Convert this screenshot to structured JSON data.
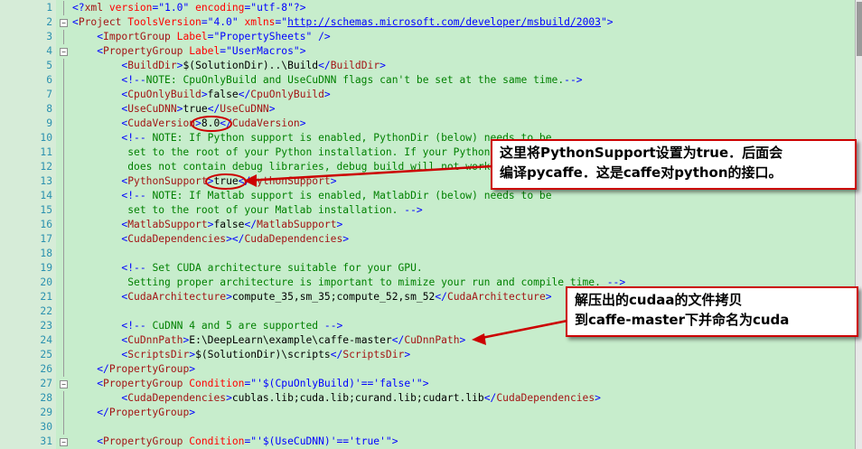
{
  "lines": [
    {
      "n": "1",
      "fold": "",
      "tokens": [
        [
          "t-blue",
          "<?"
        ],
        [
          "t-tag",
          "xml"
        ],
        [
          "t-attr",
          " version"
        ],
        [
          "t-blue",
          "="
        ],
        [
          "t-str",
          "\"1.0\""
        ],
        [
          "t-attr",
          " encoding"
        ],
        [
          "t-blue",
          "="
        ],
        [
          "t-str",
          "\"utf-8\""
        ],
        [
          "t-blue",
          "?>"
        ]
      ]
    },
    {
      "n": "2",
      "fold": "−",
      "tokens": [
        [
          "t-blue",
          "<"
        ],
        [
          "t-tag",
          "Project"
        ],
        [
          "t-attr",
          " ToolsVersion"
        ],
        [
          "t-blue",
          "="
        ],
        [
          "t-str",
          "\"4.0\""
        ],
        [
          "t-attr",
          " xmlns"
        ],
        [
          "t-blue",
          "="
        ],
        [
          "t-str",
          "\""
        ],
        [
          "t-url",
          "http://schemas.microsoft.com/developer/msbuild/2003"
        ],
        [
          "t-str",
          "\""
        ],
        [
          "t-blue",
          ">"
        ]
      ]
    },
    {
      "n": "3",
      "fold": "",
      "tokens": [
        [
          "t-txt",
          "    "
        ],
        [
          "t-blue",
          "<"
        ],
        [
          "t-tag",
          "ImportGroup"
        ],
        [
          "t-attr",
          " Label"
        ],
        [
          "t-blue",
          "="
        ],
        [
          "t-str",
          "\"PropertySheets\""
        ],
        [
          "t-blue",
          " />"
        ]
      ]
    },
    {
      "n": "4",
      "fold": "−",
      "tokens": [
        [
          "t-txt",
          "    "
        ],
        [
          "t-blue",
          "<"
        ],
        [
          "t-tag",
          "PropertyGroup"
        ],
        [
          "t-attr",
          " Label"
        ],
        [
          "t-blue",
          "="
        ],
        [
          "t-str",
          "\"UserMacros\""
        ],
        [
          "t-blue",
          ">"
        ]
      ]
    },
    {
      "n": "5",
      "fold": "",
      "tokens": [
        [
          "t-txt",
          "        "
        ],
        [
          "t-blue",
          "<"
        ],
        [
          "t-tag",
          "BuildDir"
        ],
        [
          "t-blue",
          ">"
        ],
        [
          "t-txt",
          "$(SolutionDir)..\\Build"
        ],
        [
          "t-blue",
          "</"
        ],
        [
          "t-tag",
          "BuildDir"
        ],
        [
          "t-blue",
          ">"
        ]
      ]
    },
    {
      "n": "6",
      "fold": "",
      "tokens": [
        [
          "t-txt",
          "        "
        ],
        [
          "t-blue",
          "<!--"
        ],
        [
          "t-com",
          "NOTE: CpuOnlyBuild and UseCuDNN flags can't be set at the same time."
        ],
        [
          "t-blue",
          "-->"
        ]
      ]
    },
    {
      "n": "7",
      "fold": "",
      "tokens": [
        [
          "t-txt",
          "        "
        ],
        [
          "t-blue",
          "<"
        ],
        [
          "t-tag",
          "CpuOnlyBuild"
        ],
        [
          "t-blue",
          ">"
        ],
        [
          "t-txt",
          "false"
        ],
        [
          "t-blue",
          "</"
        ],
        [
          "t-tag",
          "CpuOnlyBuild"
        ],
        [
          "t-blue",
          ">"
        ]
      ]
    },
    {
      "n": "8",
      "fold": "",
      "tokens": [
        [
          "t-txt",
          "        "
        ],
        [
          "t-blue",
          "<"
        ],
        [
          "t-tag",
          "UseCuDNN"
        ],
        [
          "t-blue",
          ">"
        ],
        [
          "t-txt",
          "true"
        ],
        [
          "t-blue",
          "</"
        ],
        [
          "t-tag",
          "UseCuDNN"
        ],
        [
          "t-blue",
          ">"
        ]
      ]
    },
    {
      "n": "9",
      "fold": "",
      "tokens": [
        [
          "t-txt",
          "        "
        ],
        [
          "t-blue",
          "<"
        ],
        [
          "t-tag",
          "CudaVersion"
        ],
        [
          "t-blue",
          ">"
        ],
        [
          "t-txt",
          "8.0"
        ],
        [
          "t-blue",
          "</"
        ],
        [
          "t-tag",
          "CudaVersion"
        ],
        [
          "t-blue",
          ">"
        ]
      ]
    },
    {
      "n": "10",
      "fold": "",
      "tokens": [
        [
          "t-txt",
          "        "
        ],
        [
          "t-blue",
          "<!--"
        ],
        [
          "t-com",
          " NOTE: If Python support is enabled, PythonDir (below) needs to be"
        ]
      ]
    },
    {
      "n": "11",
      "fold": "",
      "tokens": [
        [
          "t-com",
          "         set to the root of your Python installation. If your Python installation"
        ]
      ]
    },
    {
      "n": "12",
      "fold": "",
      "tokens": [
        [
          "t-com",
          "         does not contain debug libraries, debug build will not work. "
        ],
        [
          "t-blue",
          "-->"
        ]
      ]
    },
    {
      "n": "13",
      "fold": "",
      "tokens": [
        [
          "t-txt",
          "        "
        ],
        [
          "t-blue",
          "<"
        ],
        [
          "t-tag",
          "PythonSupport"
        ],
        [
          "t-blue",
          ">"
        ],
        [
          "t-txt",
          "true"
        ],
        [
          "t-blue",
          "</"
        ],
        [
          "t-tag",
          "PythonSupport"
        ],
        [
          "t-blue",
          ">"
        ]
      ]
    },
    {
      "n": "14",
      "fold": "",
      "tokens": [
        [
          "t-txt",
          "        "
        ],
        [
          "t-blue",
          "<!--"
        ],
        [
          "t-com",
          " NOTE: If Matlab support is enabled, MatlabDir (below) needs to be"
        ]
      ]
    },
    {
      "n": "15",
      "fold": "",
      "tokens": [
        [
          "t-com",
          "         set to the root of your Matlab installation. "
        ],
        [
          "t-blue",
          "-->"
        ]
      ]
    },
    {
      "n": "16",
      "fold": "",
      "tokens": [
        [
          "t-txt",
          "        "
        ],
        [
          "t-blue",
          "<"
        ],
        [
          "t-tag",
          "MatlabSupport"
        ],
        [
          "t-blue",
          ">"
        ],
        [
          "t-txt",
          "false"
        ],
        [
          "t-blue",
          "</"
        ],
        [
          "t-tag",
          "MatlabSupport"
        ],
        [
          "t-blue",
          ">"
        ]
      ]
    },
    {
      "n": "17",
      "fold": "",
      "tokens": [
        [
          "t-txt",
          "        "
        ],
        [
          "t-blue",
          "<"
        ],
        [
          "t-tag",
          "CudaDependencies"
        ],
        [
          "t-blue",
          "></"
        ],
        [
          "t-tag",
          "CudaDependencies"
        ],
        [
          "t-blue",
          ">"
        ]
      ]
    },
    {
      "n": "18",
      "fold": "",
      "tokens": []
    },
    {
      "n": "19",
      "fold": "",
      "tokens": [
        [
          "t-txt",
          "        "
        ],
        [
          "t-blue",
          "<!--"
        ],
        [
          "t-com",
          " Set CUDA architecture suitable for your GPU."
        ]
      ]
    },
    {
      "n": "20",
      "fold": "",
      "tokens": [
        [
          "t-com",
          "         Setting proper architecture is important to mimize your run and compile time. "
        ],
        [
          "t-blue",
          "-->"
        ]
      ]
    },
    {
      "n": "21",
      "fold": "",
      "tokens": [
        [
          "t-txt",
          "        "
        ],
        [
          "t-blue",
          "<"
        ],
        [
          "t-tag",
          "CudaArchitecture"
        ],
        [
          "t-blue",
          ">"
        ],
        [
          "t-txt",
          "compute_35,sm_35;compute_52,sm_52"
        ],
        [
          "t-blue",
          "</"
        ],
        [
          "t-tag",
          "CudaArchitecture"
        ],
        [
          "t-blue",
          ">"
        ]
      ]
    },
    {
      "n": "22",
      "fold": "",
      "tokens": []
    },
    {
      "n": "23",
      "fold": "",
      "tokens": [
        [
          "t-txt",
          "        "
        ],
        [
          "t-blue",
          "<!--"
        ],
        [
          "t-com",
          " CuDNN 4 and 5 are supported "
        ],
        [
          "t-blue",
          "-->"
        ]
      ]
    },
    {
      "n": "24",
      "fold": "",
      "tokens": [
        [
          "t-txt",
          "        "
        ],
        [
          "t-blue",
          "<"
        ],
        [
          "t-tag",
          "CuDnnPath"
        ],
        [
          "t-blue",
          ">"
        ],
        [
          "t-txt",
          "E:\\DeepLearn\\example\\caffe-master"
        ],
        [
          "t-blue",
          "</"
        ],
        [
          "t-tag",
          "CuDnnPath"
        ],
        [
          "t-blue",
          ">"
        ]
      ]
    },
    {
      "n": "25",
      "fold": "",
      "tokens": [
        [
          "t-txt",
          "        "
        ],
        [
          "t-blue",
          "<"
        ],
        [
          "t-tag",
          "ScriptsDir"
        ],
        [
          "t-blue",
          ">"
        ],
        [
          "t-txt",
          "$(SolutionDir)\\scripts"
        ],
        [
          "t-blue",
          "</"
        ],
        [
          "t-tag",
          "ScriptsDir"
        ],
        [
          "t-blue",
          ">"
        ]
      ]
    },
    {
      "n": "26",
      "fold": "",
      "tokens": [
        [
          "t-txt",
          "    "
        ],
        [
          "t-blue",
          "</"
        ],
        [
          "t-tag",
          "PropertyGroup"
        ],
        [
          "t-blue",
          ">"
        ]
      ]
    },
    {
      "n": "27",
      "fold": "−",
      "tokens": [
        [
          "t-txt",
          "    "
        ],
        [
          "t-blue",
          "<"
        ],
        [
          "t-tag",
          "PropertyGroup"
        ],
        [
          "t-attr",
          " Condition"
        ],
        [
          "t-blue",
          "="
        ],
        [
          "t-str",
          "\"'$(CpuOnlyBuild)'=='false'\""
        ],
        [
          "t-blue",
          ">"
        ]
      ]
    },
    {
      "n": "28",
      "fold": "",
      "tokens": [
        [
          "t-txt",
          "        "
        ],
        [
          "t-blue",
          "<"
        ],
        [
          "t-tag",
          "CudaDependencies"
        ],
        [
          "t-blue",
          ">"
        ],
        [
          "t-txt",
          "cublas.lib;cuda.lib;curand.lib;cudart.lib"
        ],
        [
          "t-blue",
          "</"
        ],
        [
          "t-tag",
          "CudaDependencies"
        ],
        [
          "t-blue",
          ">"
        ]
      ]
    },
    {
      "n": "29",
      "fold": "",
      "tokens": [
        [
          "t-txt",
          "    "
        ],
        [
          "t-blue",
          "</"
        ],
        [
          "t-tag",
          "PropertyGroup"
        ],
        [
          "t-blue",
          ">"
        ]
      ]
    },
    {
      "n": "30",
      "fold": "",
      "tokens": []
    },
    {
      "n": "31",
      "fold": "−",
      "tokens": [
        [
          "t-txt",
          "    "
        ],
        [
          "t-blue",
          "<"
        ],
        [
          "t-tag",
          "PropertyGroup"
        ],
        [
          "t-attr",
          " Condition"
        ],
        [
          "t-blue",
          "="
        ],
        [
          "t-str",
          "\"'$(UseCuDNN)'=='true'\""
        ],
        [
          "t-blue",
          ">"
        ]
      ]
    }
  ],
  "callouts": {
    "python_support": [
      "这里将PythonSupport设置为true．后面会",
      "编译pycaffe．这是caffe对python的接口。"
    ],
    "cudnn_path": [
      "解压出的cudaa的文件拷贝",
      "到caffe-master下并命名为cuda"
    ]
  },
  "colors": {
    "background": "#c7edcc",
    "line_numbers": "#2b91af",
    "annotation": "#cc0000"
  }
}
